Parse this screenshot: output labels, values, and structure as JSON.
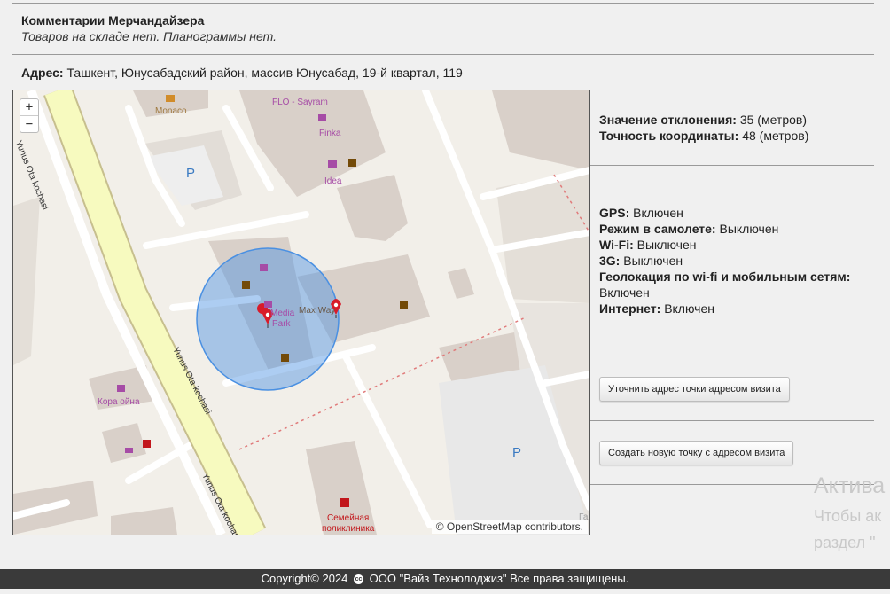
{
  "comments": {
    "title": "Комментарии Мерчандайзера",
    "text": "Товаров на складе нет. Планограммы нет."
  },
  "address": {
    "label": "Адрес:",
    "value": "Ташкент, Юнусабадский район, массив Юнусабад, 19-й квартал, 119"
  },
  "map": {
    "zoom_in": "+",
    "zoom_out": "−",
    "attribution": "© OpenStreetMap contributors.",
    "labels": {
      "monaco": "Monaco",
      "flo": "FLO - Sayram",
      "finka": "Finka",
      "idea": "Idea",
      "maxway": "Max Way",
      "media_park_1": "Media",
      "media_park_2": "Park",
      "kora": "Кора ойна",
      "street1": "Yunus Ota kochasi",
      "street2": "Yunus Ota kochasi",
      "street3": "Yunus Ota kochasi",
      "clinic1": "Семейная",
      "clinic2": "поликлиника",
      "parking": "P",
      "ga": "Га"
    },
    "colors": {
      "background": "#f2efe9",
      "road": "#ffffff",
      "primary_road": "#f7fabf",
      "building": "#d9d0c9",
      "accuracy_circle": "#4a90e2",
      "marker": "#d81b2a"
    }
  },
  "deviation": {
    "label": "Значение отклонения:",
    "value": "35 (метров)"
  },
  "accuracy": {
    "label": "Точность координаты:",
    "value": "48 (метров)"
  },
  "status": {
    "gps_label": "GPS:",
    "gps_value": "Включен",
    "airplane_label": "Режим в самолете:",
    "airplane_value": "Выключен",
    "wifi_label": "Wi-Fi:",
    "wifi_value": "Выключен",
    "g3_label": "3G:",
    "g3_value": "Выключен",
    "geo_label": "Геолокация по wi-fi и мобильным сетям:",
    "geo_value": "Включен",
    "internet_label": "Интернет:",
    "internet_value": "Включен"
  },
  "buttons": {
    "refine": "Уточнить адрес точки адресом визита",
    "create": "Создать новую точку с адресом визита"
  },
  "watermark": {
    "line1": "Актива",
    "line2": "Чтобы ак",
    "line3": "раздел \""
  },
  "footer": {
    "prefix": "Copyright© 2024",
    "cc": "cc",
    "suffix": "ООО \"Вайз Технолоджиз\" Все права защищены."
  }
}
